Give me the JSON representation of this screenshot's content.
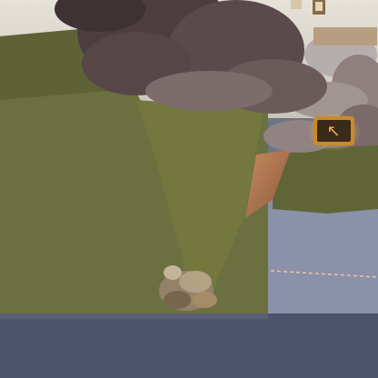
{
  "scene": {
    "description_visible_text": "",
    "hud": {
      "sign_glyph": "↖",
      "bridge_visible": true
    },
    "colors": {
      "sky": "#d9d3c8",
      "water_top": "#9aa0b4",
      "water_bottom": "#4a4f66",
      "grass": "#6f7340",
      "grass_dark": "#5b5e35",
      "rock": "#5a4a4a",
      "rock_light": "#7a6865",
      "dirt": "#b87a52",
      "sign_glow": "#f0b040"
    }
  }
}
